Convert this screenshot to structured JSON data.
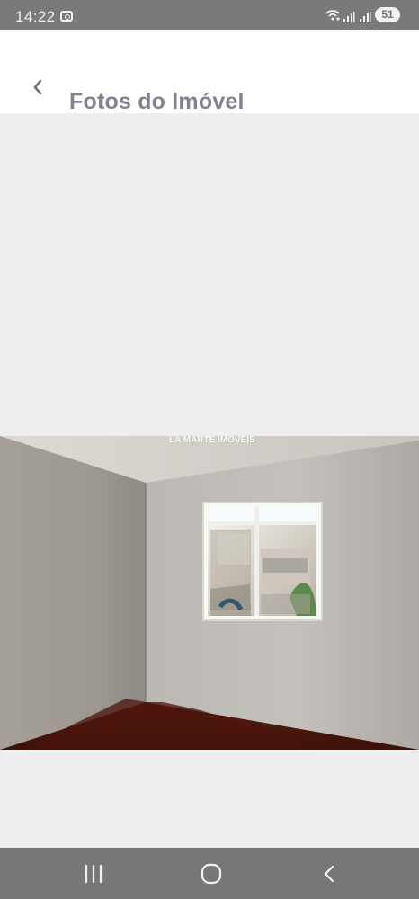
{
  "status_bar": {
    "time": "14:22",
    "battery": "51",
    "icons": [
      "screenshot-icon",
      "wifi-icon",
      "signal-icon",
      "signal-icon",
      "battery-icon"
    ]
  },
  "header": {
    "title": "Fotos do Imóvel",
    "back_icon": "chevron-left-icon"
  },
  "gallery": {
    "watermark": "LA MARTE IMÓVEIS",
    "image": "empty-room-photo"
  },
  "navigation": {
    "buttons": [
      "recent-apps-icon",
      "home-icon",
      "back-icon"
    ]
  },
  "colors": {
    "status_bar": "#7a7a7d",
    "header_background": "#ffffff",
    "title": "#838390",
    "gallery_background": "#eeeeef",
    "navigation_bar": "#77777a"
  }
}
